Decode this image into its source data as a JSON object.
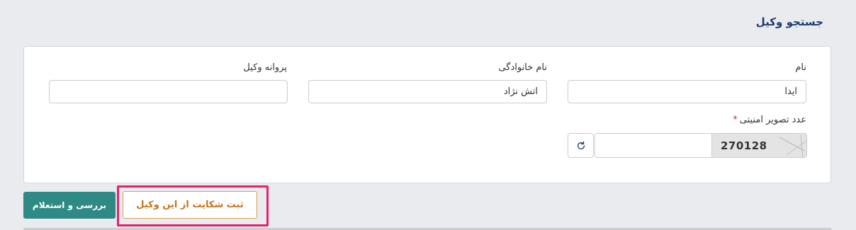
{
  "page": {
    "title": "جستجو وکیل"
  },
  "form": {
    "first_name": {
      "label": "نام",
      "value": "آیدا",
      "placeholder": ""
    },
    "last_name": {
      "label": "نام خانوادگی",
      "value": "آتش نژاد",
      "placeholder": ""
    },
    "license": {
      "label": "پروانه وکیل",
      "value": "",
      "placeholder": ""
    },
    "captcha": {
      "label": "عدد تصویر امنیتی",
      "required_mark": "*",
      "image_text": "270128",
      "value": "",
      "refresh_icon": "refresh-icon"
    }
  },
  "actions": {
    "search_label": "بررسی و استعلام",
    "complaint_label": "ثبت شکایت از این وکیل"
  },
  "colors": {
    "title": "#1d3b72",
    "primary_button": "#2f8a86",
    "complaint_text": "#c8731d",
    "highlight": "#e8206e"
  }
}
